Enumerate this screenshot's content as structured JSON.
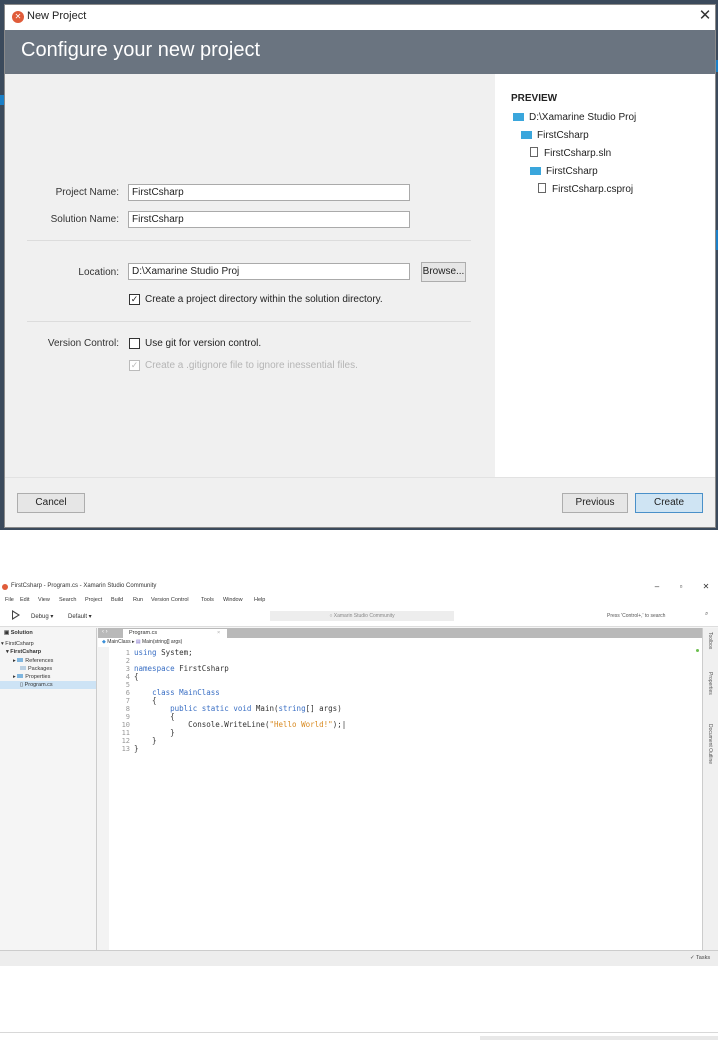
{
  "dialog": {
    "window_title": "New Project",
    "close_glyph": "✕",
    "heading": "Configure your new project",
    "project_name_label": "Project Name:",
    "project_name_value": "FirstCsharp",
    "solution_name_label": "Solution Name:",
    "solution_name_value": "FirstCsharp",
    "location_label": "Location:",
    "location_value": "D:\\Xamarine Studio Proj",
    "browse_label": "Browse...",
    "create_dir_label": "Create a project directory within the solution directory.",
    "create_dir_checked": true,
    "version_control_label": "Version Control:",
    "use_git_label": "Use git for version control.",
    "use_git_checked": false,
    "gitignore_label": "Create a .gitignore file to ignore inessential files.",
    "gitignore_checked": true,
    "preview": {
      "title": "PREVIEW",
      "items": [
        {
          "type": "folder",
          "label": "D:\\Xamarine Studio Proj"
        },
        {
          "type": "folder",
          "label": "FirstCsharp"
        },
        {
          "type": "file",
          "label": "FirstCsharp.sln"
        },
        {
          "type": "folder",
          "label": "FirstCsharp"
        },
        {
          "type": "file",
          "label": "FirstCsharp.csproj"
        }
      ]
    },
    "cancel_label": "Cancel",
    "previous_label": "Previous",
    "create_label": "Create"
  },
  "ide": {
    "window_title": "FirstCsharp - Program.cs - Xamarin Studio Community",
    "menu": [
      "File",
      "Edit",
      "View",
      "Search",
      "Project",
      "Build",
      "Run",
      "Version Control",
      "Tools",
      "Window",
      "Help"
    ],
    "config": "Debug",
    "target": "Default",
    "status_text": "Xamarin Studio Community",
    "search_placeholder": "Press 'Control+,' to search",
    "pad_title": "Solution",
    "tree": [
      {
        "label": "FirstCsharp"
      },
      {
        "label": "FirstCsharp"
      },
      {
        "label": "References"
      },
      {
        "label": "Packages"
      },
      {
        "label": "Properties"
      },
      {
        "label": "Program.cs"
      }
    ],
    "tab_label": "Program.cs",
    "breadcrumb_class": "MainClass",
    "breadcrumb_method": "Main(string[] args)",
    "code_lines": [
      "1",
      "2",
      "3",
      "4",
      "5",
      "6",
      "7",
      "8",
      "9",
      "10",
      "11",
      "12",
      "13"
    ],
    "right_pads": [
      "Toolbox",
      "Properties",
      "Document Outline"
    ],
    "tasks_label": "✓ Tasks"
  }
}
